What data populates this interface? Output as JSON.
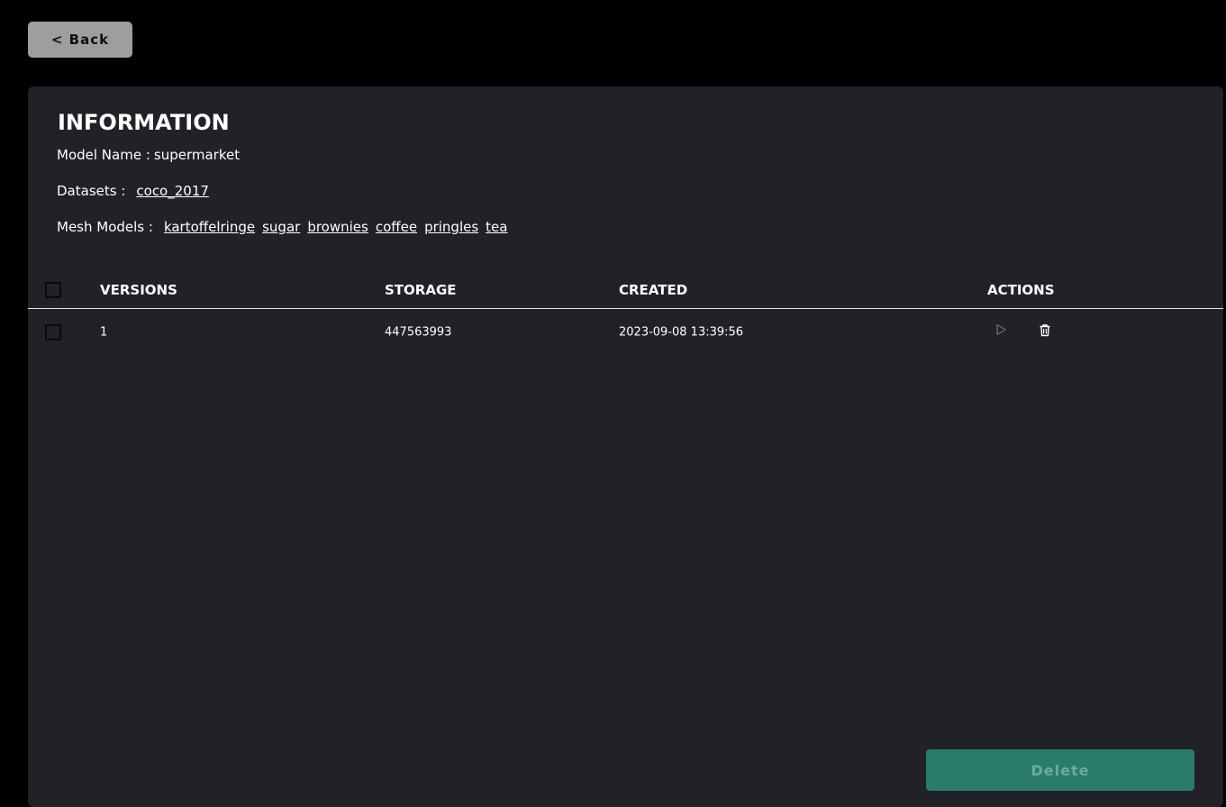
{
  "nav": {
    "back_label": "< Back"
  },
  "information": {
    "title": "INFORMATION",
    "model_name_label": "Model Name :",
    "model_name_value": "supermarket",
    "datasets_label": "Datasets :",
    "datasets": [
      "coco_2017"
    ],
    "mesh_models_label": "Mesh Models :",
    "mesh_models": [
      "kartoffelringe",
      "sugar",
      "brownies",
      "coffee",
      "pringles",
      "tea"
    ]
  },
  "table": {
    "headers": {
      "versions": "VERSIONS",
      "storage": "STORAGE",
      "created": "CREATED",
      "actions": "ACTIONS"
    },
    "rows": [
      {
        "version": "1",
        "storage": "447563993",
        "created": "2023-09-08 13:39:56"
      }
    ]
  },
  "footer": {
    "delete_label": "Delete"
  },
  "icons": {
    "run": "play-icon",
    "delete": "trash-icon"
  },
  "colors": {
    "panel": "#212127",
    "accent": "#2a7c6a",
    "back_button": "#9e9e9e"
  }
}
